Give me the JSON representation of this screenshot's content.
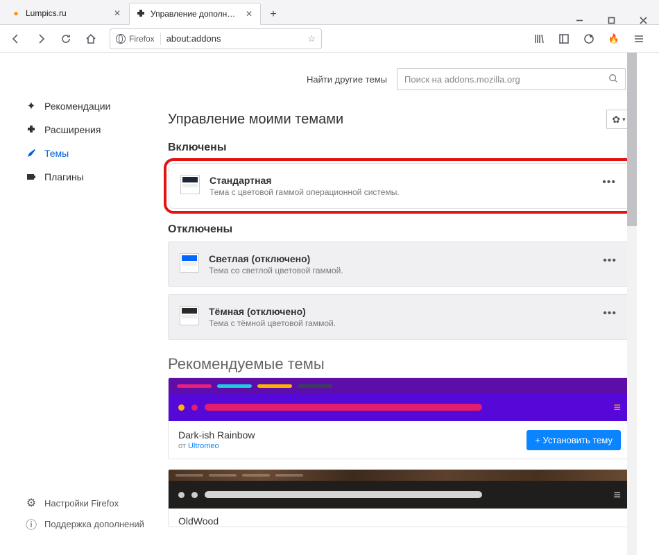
{
  "tabs": [
    {
      "label": "Lumpics.ru"
    },
    {
      "label": "Управление дополнениями"
    }
  ],
  "url": {
    "identity": "Firefox",
    "text": "about:addons"
  },
  "sidebar": {
    "recommendations": "Рекомендации",
    "extensions": "Расширения",
    "themes": "Темы",
    "plugins": "Плагины",
    "firefox_settings": "Настройки Firefox",
    "addons_support": "Поддержка дополнений"
  },
  "search": {
    "label": "Найти другие темы",
    "placeholder": "Поиск на addons.mozilla.org"
  },
  "page_title": "Управление моими темами",
  "sections": {
    "enabled": "Включены",
    "disabled": "Отключены",
    "recommended": "Рекомендуемые темы"
  },
  "themes": {
    "default": {
      "name": "Стандартная",
      "desc": "Тема с цветовой гаммой операционной системы."
    },
    "light": {
      "name": "Светлая (отключено)",
      "desc": "Тема со светлой цветовой гаммой."
    },
    "dark": {
      "name": "Тёмная (отключено)",
      "desc": "Тема с тёмной цветовой гаммой."
    }
  },
  "recommended": {
    "rainbow": {
      "name": "Dark-ish Rainbow",
      "by_label": "от",
      "author": "Ultromeo",
      "install": "+ Установить тему"
    },
    "oldwood": {
      "name": "OldWood"
    }
  }
}
